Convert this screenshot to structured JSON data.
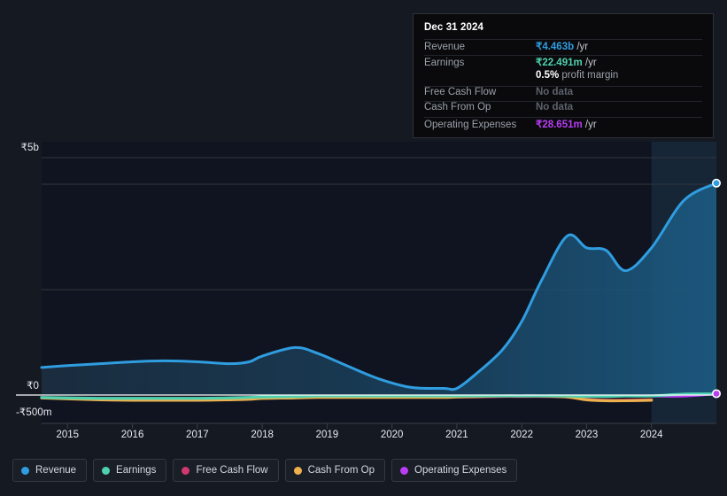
{
  "tooltip": {
    "date": "Dec 31 2024",
    "rows": [
      {
        "label": "Revenue",
        "value": "₹4.463b",
        "unit": " /yr",
        "color": "#2f9de0",
        "nodata": false
      },
      {
        "label": "Earnings",
        "value": "₹22.491m",
        "unit": " /yr",
        "color": "#4fd1b0",
        "nodata": false
      },
      {
        "label": "",
        "value": "0.5%",
        "unit": " profit margin",
        "color": "#ffffff",
        "nodata": false,
        "margin": true
      },
      {
        "label": "Free Cash Flow",
        "value": "No data",
        "unit": "",
        "color": "#5d626c",
        "nodata": true
      },
      {
        "label": "Cash From Op",
        "value": "No data",
        "unit": "",
        "color": "#5d626c",
        "nodata": true
      },
      {
        "label": "Operating Expenses",
        "value": "₹28.651m",
        "unit": " /yr",
        "color": "#b83df5",
        "nodata": false
      }
    ]
  },
  "legend": {
    "items": [
      {
        "label": "Revenue",
        "color": "#2f9de0"
      },
      {
        "label": "Earnings",
        "color": "#4fd1b0"
      },
      {
        "label": "Free Cash Flow",
        "color": "#d1386f"
      },
      {
        "label": "Cash From Op",
        "color": "#eeb04d"
      },
      {
        "label": "Operating Expenses",
        "color": "#b83df5"
      }
    ]
  },
  "axes": {
    "y_top_label": "₹5b",
    "y_zero_label": "₹0",
    "y_neg_label": "-₹500m",
    "x_ticks": [
      "2015",
      "2016",
      "2017",
      "2018",
      "2019",
      "2020",
      "2021",
      "2022",
      "2023",
      "2024"
    ]
  },
  "chart_data": {
    "type": "area",
    "title": "",
    "xlabel": "",
    "ylabel": "",
    "ylim": [
      -500000000,
      5000000000
    ],
    "ytick_labels": [
      "₹5b",
      "₹0",
      "-₹500m"
    ],
    "ytick_values": [
      5000000000,
      0,
      -500000000
    ],
    "grid": true,
    "legend_position": "bottom",
    "currency": "INR",
    "x": [
      2014.6,
      2015,
      2015.5,
      2016,
      2016.5,
      2017,
      2017.5,
      2017.8,
      2018,
      2018.5,
      2018.85,
      2019.3,
      2019.8,
      2020.3,
      2020.8,
      2021,
      2021.3,
      2021.7,
      2022,
      2022.3,
      2022.7,
      2023,
      2023.3,
      2023.6,
      2024,
      2024.5,
      2025.0
    ],
    "forecast_start": 2024.0,
    "series": [
      {
        "name": "Revenue",
        "color": "#2f9de0",
        "filled": true,
        "unit": "INR",
        "values": [
          0.58,
          0.62,
          0.66,
          0.7,
          0.72,
          0.7,
          0.66,
          0.7,
          0.82,
          1.0,
          0.88,
          0.62,
          0.34,
          0.16,
          0.14,
          0.14,
          0.45,
          0.95,
          1.55,
          2.4,
          3.35,
          3.1,
          3.05,
          2.62,
          3.1,
          4.1,
          4.463
        ]
      },
      {
        "name": "Earnings",
        "color": "#4fd1b0",
        "filled": false,
        "unit": "INR",
        "values": [
          -0.05,
          -0.06,
          -0.07,
          -0.07,
          -0.07,
          -0.07,
          -0.06,
          -0.05,
          -0.04,
          -0.03,
          -0.02,
          -0.02,
          -0.02,
          -0.02,
          -0.02,
          -0.02,
          -0.02,
          -0.02,
          -0.02,
          -0.02,
          -0.02,
          -0.03,
          -0.03,
          -0.02,
          -0.02,
          0.02,
          0.022491
        ]
      },
      {
        "name": "Free Cash Flow",
        "color": "#d1386f",
        "filled": false,
        "unit": "INR",
        "values": [
          -0.06,
          -0.07,
          -0.09,
          -0.1,
          -0.1,
          -0.1,
          -0.09,
          -0.08,
          -0.06,
          -0.05,
          -0.04,
          -0.04,
          -0.04,
          -0.04,
          -0.04,
          -0.04,
          -0.04,
          -0.03,
          -0.03,
          -0.03,
          -0.04,
          -0.09,
          -0.11,
          -0.11,
          -0.1,
          null,
          null
        ]
      },
      {
        "name": "Cash From Op",
        "color": "#eeb04d",
        "filled": false,
        "unit": "INR",
        "values": [
          -0.06,
          -0.08,
          -0.1,
          -0.11,
          -0.11,
          -0.11,
          -0.1,
          -0.09,
          -0.07,
          -0.06,
          -0.05,
          -0.05,
          -0.05,
          -0.05,
          -0.05,
          -0.04,
          -0.03,
          -0.02,
          -0.02,
          -0.02,
          -0.04,
          -0.1,
          -0.12,
          -0.12,
          -0.11,
          null,
          null
        ]
      },
      {
        "name": "Operating Expenses",
        "color": "#b83df5",
        "filled": false,
        "unit": "INR",
        "values": [
          null,
          null,
          null,
          null,
          null,
          null,
          null,
          null,
          null,
          null,
          -0.02,
          -0.02,
          -0.02,
          -0.02,
          -0.02,
          -0.02,
          -0.02,
          -0.02,
          -0.02,
          -0.02,
          -0.02,
          -0.02,
          -0.02,
          -0.02,
          -0.02,
          -0.02,
          0.028651
        ]
      }
    ]
  }
}
